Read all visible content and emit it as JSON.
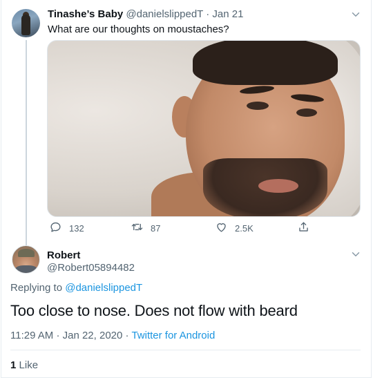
{
  "tweet": {
    "author_name": "Tinashe’s Baby",
    "author_handle": "@danielslippedT",
    "separator": "·",
    "date": "Jan 21",
    "text": "What are our thoughts on moustaches?",
    "actions": {
      "reply_count": "132",
      "retweet_count": "87",
      "like_count": "2.5K"
    },
    "icons": {
      "reply": "reply-icon",
      "retweet": "retweet-icon",
      "like": "heart-icon",
      "share": "share-icon",
      "more": "chevron-down-icon"
    }
  },
  "reply": {
    "author_name": "Robert",
    "author_handle": "@Robert05894482",
    "replying_prefix": "Replying to",
    "replying_to": "@danielslippedT",
    "text": "Too close to nose. Does not flow with beard",
    "time": "11:29 AM",
    "date": "Jan 22, 2020",
    "separator": "·",
    "source": "Twitter for Android",
    "like_count": "1",
    "like_label": "Like"
  },
  "colors": {
    "text_primary": "#0f1419",
    "text_secondary": "#536471",
    "accent_link": "#1b95e0",
    "thread_line": "#ccd6dd",
    "divider": "#e6ecf0"
  }
}
